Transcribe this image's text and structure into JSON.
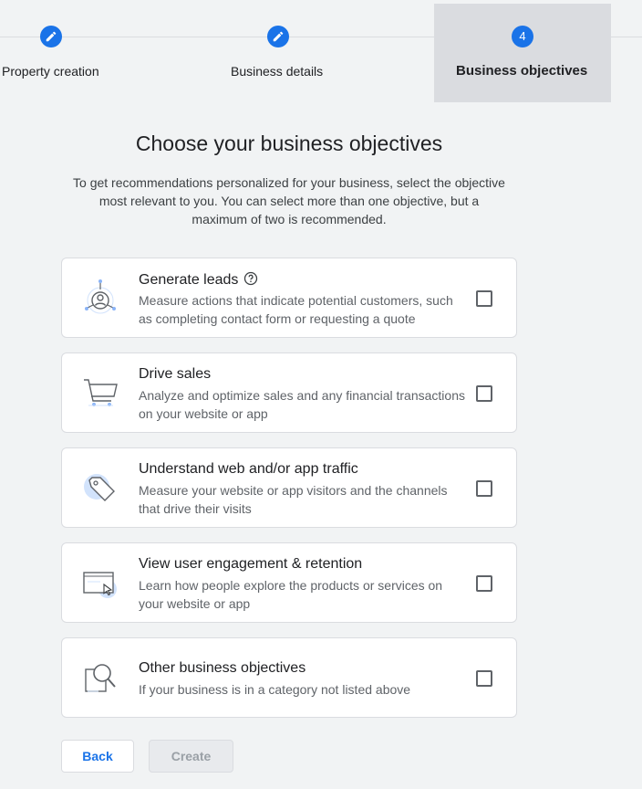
{
  "stepper": {
    "steps": [
      {
        "label": "Property creation",
        "marker": "pencil-icon"
      },
      {
        "label": "Business details",
        "marker": "pencil-icon"
      },
      {
        "label": "Business objectives",
        "marker": "4"
      }
    ]
  },
  "main": {
    "heading": "Choose your business objectives",
    "description": "To get recommendations personalized for your business, select the objective most relevant to you. You can select more than one objective, but a maximum of two is recommended."
  },
  "objectives": [
    {
      "title": "Generate leads",
      "description": "Measure actions that indicate potential customers, such as completing contact form or requesting a quote",
      "icon": "leads-target-icon",
      "checked": false
    },
    {
      "title": "Drive sales",
      "description": "Analyze and optimize sales and any financial transactions on your website or app",
      "icon": "shopping-cart-icon",
      "checked": false
    },
    {
      "title": "Understand web and/or app traffic",
      "description": "Measure your website or app visitors and the channels that drive their visits",
      "icon": "tag-icon",
      "checked": false
    },
    {
      "title": "View user engagement & retention",
      "description": "Learn how people explore the products or services on your website or app",
      "icon": "browser-cursor-icon",
      "checked": false
    },
    {
      "title": "Other business objectives",
      "description": "If your business is in a category not listed above",
      "icon": "magnifier-icon",
      "checked": false
    }
  ],
  "footer": {
    "back_label": "Back",
    "create_label": "Create"
  },
  "colors": {
    "accent": "#1a73e8",
    "background": "#f1f3f4",
    "active_step_bg": "#dadce0",
    "icon_highlight": "#d2e3fc"
  }
}
